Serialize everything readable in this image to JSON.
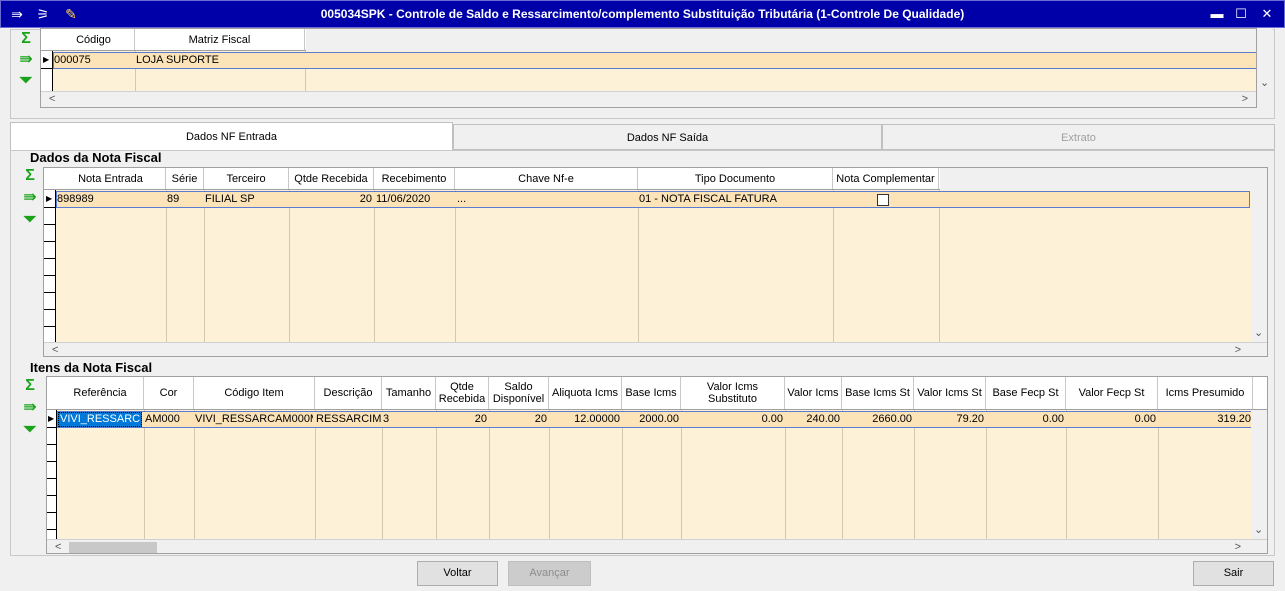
{
  "window": {
    "title": "005034SPK - Controle de Saldo e Ressarcimento/complemento Substituição Tributária (1-Controle De Qualidade)",
    "controls": {
      "minimize": "▬",
      "maximize": "☐",
      "close": "✕"
    }
  },
  "top_grid": {
    "headers": [
      "Código",
      "Matriz Fiscal"
    ],
    "rows": [
      {
        "codigo": "000075",
        "matriz": "LOJA SUPORTE"
      }
    ]
  },
  "tabs": [
    {
      "label": "Dados NF Entrada",
      "state": "active"
    },
    {
      "label": "Dados NF Saída",
      "state": "normal"
    },
    {
      "label": "Extrato",
      "state": "disabled"
    }
  ],
  "nota_fiscal": {
    "title": "Dados da Nota Fiscal",
    "headers": [
      "Nota Entrada",
      "Série",
      "Terceiro",
      "Qtde Recebida",
      "Recebimento",
      "Chave Nf-e",
      "Tipo Documento",
      "Nota Complementar"
    ],
    "rows": [
      {
        "nota": "898989",
        "serie": "89",
        "terceiro": "FILIAL SP",
        "qtde": "20",
        "recebimento": "11/06/2020",
        "chave": "...",
        "tipo": "01  - NOTA FISCAL FATURA",
        "complementar": false
      }
    ]
  },
  "itens": {
    "title": "Itens da Nota Fiscal",
    "headers": [
      "Referência",
      "Cor",
      "Código Item",
      "Descrição",
      "Tamanho",
      "Qtde Recebida",
      "Saldo Disponível",
      "Aliquota Icms",
      "Base Icms",
      "Valor Icms Substituto",
      "Valor Icms",
      "Base Icms St",
      "Valor Icms St",
      "Base Fecp St",
      "Valor Fecp St",
      "Icms Presumido"
    ],
    "rows": [
      {
        "referencia": "VIVI_RESSARC",
        "cor": "AM000",
        "codigo": "VIVI_RESSARCAM000M",
        "descricao": "RESSARCIME",
        "tamanho": "3",
        "qtde": "20",
        "saldo": "20",
        "aliquota": "12.00000",
        "base_icms": "2000.00",
        "valor_subst": "0.00",
        "valor_icms": "240.00",
        "base_st": "2660.00",
        "valor_st": "79.20",
        "base_fecp": "0.00",
        "valor_fecp": "0.00",
        "presumido": "319.20"
      }
    ]
  },
  "buttons": {
    "voltar": "Voltar",
    "avancar": "Avançar",
    "sair": "Sair"
  },
  "icons": {
    "sum": "Σ",
    "export": "⇛",
    "down": "⏷"
  },
  "colors": {
    "title_bg": "#0000a8",
    "grid_bg": "#fdf2d8",
    "row_selected": "#fde4b8",
    "cell_highlight": "#0078d7"
  }
}
